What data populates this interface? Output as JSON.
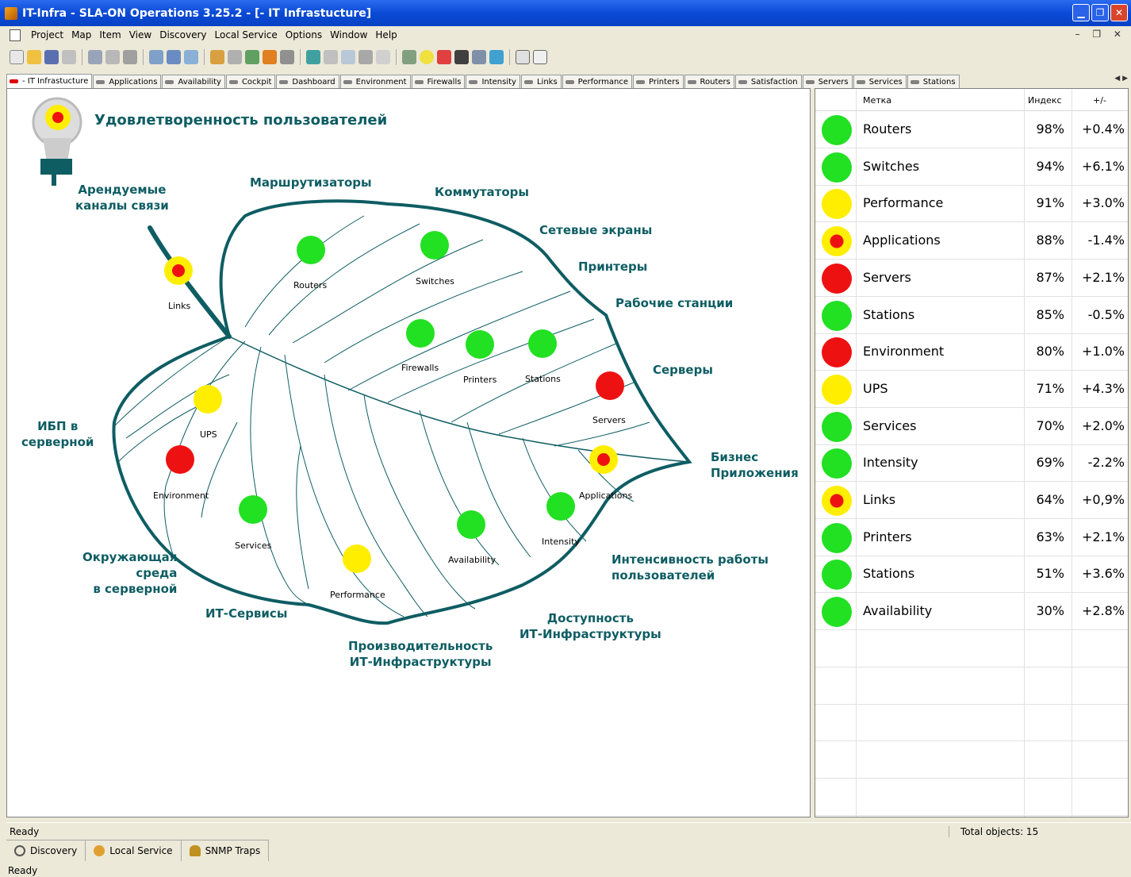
{
  "window": {
    "title": "IT-Infra - SLA-ON Operations 3.25.2 - [- IT Infrastucture]"
  },
  "menu": [
    "Project",
    "Map",
    "Item",
    "View",
    "Discovery",
    "Local Service",
    "Options",
    "Window",
    "Help"
  ],
  "tabs": [
    "- IT Infrastucture",
    "Applications",
    "Availability",
    "Cockpit",
    "Dashboard",
    "Environment",
    "Firewalls",
    "Intensity",
    "Links",
    "Performance",
    "Printers",
    "Routers",
    "Satisfaction",
    "Servers",
    "Services",
    "Stations"
  ],
  "map": {
    "title": "Удовлетворенность пользователей",
    "categories": {
      "leased": "Арендуемые\nканалы связи",
      "routers": "Маршрутизаторы",
      "switches": "Коммутаторы",
      "firewalls": "Сетевые экраны",
      "printers": "Принтеры",
      "stations": "Рабочие станции",
      "servers": "Серверы",
      "business": "Бизнес\nПриложения",
      "intensity": "Интенсивность работы\nпользователей",
      "availability": "Доступность\nИТ-Инфраструктуры",
      "performance": "Производительность\nИТ-Инфраструктуры",
      "services": "ИТ-Сервисы",
      "environment": "Окружающая\nсреда\nв серверной",
      "ups": "ИБП в\nсерверной"
    },
    "nodes": {
      "links": "Links",
      "routers": "Routers",
      "switches": "Switches",
      "firewalls": "Firewalls",
      "printers": "Printers",
      "stations": "Stations",
      "servers": "Servers",
      "ups": "UPS",
      "environment": "Environment",
      "services": "Services",
      "performance": "Performance",
      "availability": "Availability",
      "intensity": "Intensity",
      "applications": "Applications"
    }
  },
  "table": {
    "headers": {
      "label": "Метка",
      "index": "Индекс",
      "change": "+/-"
    },
    "rows": [
      {
        "label": "Routers",
        "index": "98%",
        "change": "+0.4%",
        "status": "green"
      },
      {
        "label": "Switches",
        "index": "94%",
        "change": "+6.1%",
        "status": "green"
      },
      {
        "label": "Performance",
        "index": "91%",
        "change": "+3.0%",
        "status": "yellow"
      },
      {
        "label": "Applications",
        "index": "88%",
        "change": "-1.4%",
        "status": "yellow-red"
      },
      {
        "label": "Servers",
        "index": "87%",
        "change": "+2.1%",
        "status": "red"
      },
      {
        "label": "Stations",
        "index": "85%",
        "change": "-0.5%",
        "status": "green"
      },
      {
        "label": "Environment",
        "index": "80%",
        "change": "+1.0%",
        "status": "red"
      },
      {
        "label": "UPS",
        "index": "71%",
        "change": "+4.3%",
        "status": "yellow"
      },
      {
        "label": "Services",
        "index": "70%",
        "change": "+2.0%",
        "status": "green"
      },
      {
        "label": "Intensity",
        "index": "69%",
        "change": "-2.2%",
        "status": "green"
      },
      {
        "label": "Links",
        "index": "64%",
        "change": "+0,9%",
        "status": "yellow-red"
      },
      {
        "label": "Printers",
        "index": "63%",
        "change": "+2.1%",
        "status": "green"
      },
      {
        "label": "Stations",
        "index": "51%",
        "change": "+3.6%",
        "status": "green"
      },
      {
        "label": "Availability",
        "index": "30%",
        "change": "+2.8%",
        "status": "green"
      }
    ]
  },
  "colors": {
    "green": "#22e022",
    "yellow": "#ffee00",
    "red": "#ee1111",
    "teal": "#0e5d63",
    "accent": "#0a4ad6"
  },
  "status": {
    "text": "Ready",
    "total": "Total objects: 15",
    "bottom": "Ready"
  },
  "dock": {
    "discovery": "Discovery",
    "local_service": "Local Service",
    "snmp": "SNMP Traps"
  }
}
